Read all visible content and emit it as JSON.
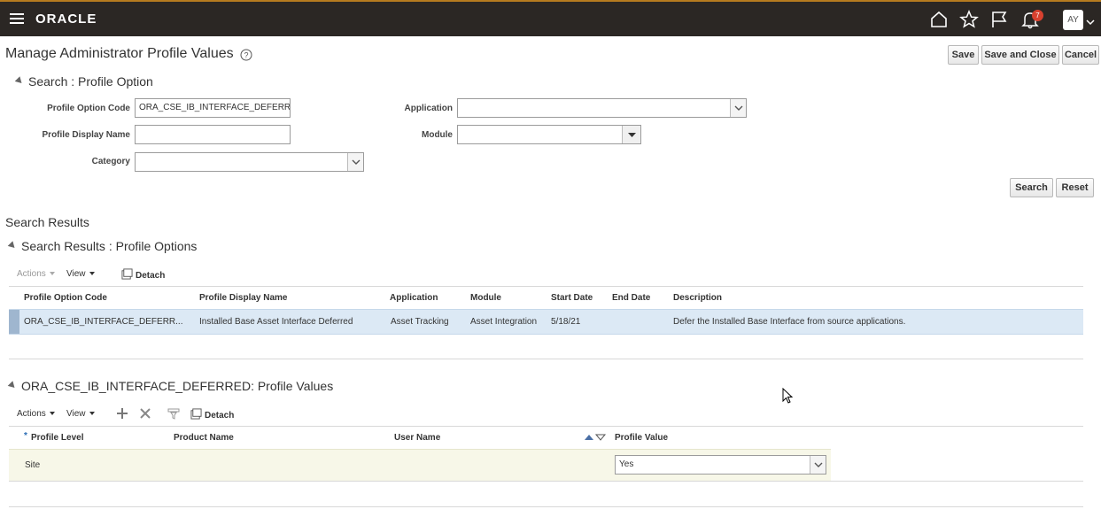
{
  "header": {
    "logo": "ORACLE",
    "notification_count": "7",
    "avatar_initials": "AY"
  },
  "page": {
    "title": "Manage Administrator Profile Values",
    "save_label": "Save",
    "save_close_label": "Save and Close",
    "cancel_label": "Cancel"
  },
  "search": {
    "section_title": "Search : Profile Option",
    "profile_option_code_label": "Profile Option Code",
    "profile_option_code_value": "ORA_CSE_IB_INTERFACE_DEFERRED",
    "profile_display_name_label": "Profile Display Name",
    "profile_display_name_value": "",
    "category_label": "Category",
    "category_value": "",
    "application_label": "Application",
    "application_value": "",
    "module_label": "Module",
    "module_value": "",
    "search_label": "Search",
    "reset_label": "Reset"
  },
  "results": {
    "heading": "Search Results",
    "section_title": "Search Results : Profile Options",
    "actions_label": "Actions",
    "view_label": "View",
    "detach_label": "Detach",
    "columns": [
      "Profile Option Code",
      "Profile Display Name",
      "Application",
      "Module",
      "Start Date",
      "End Date",
      "Description"
    ],
    "rows": [
      {
        "code": "ORA_CSE_IB_INTERFACE_DEFERR...",
        "display_name": "Installed Base Asset Interface Deferred",
        "application": "Asset Tracking",
        "module": "Asset Integration",
        "start_date": "5/18/21",
        "end_date": "",
        "description": "Defer the Installed Base Interface from source applications."
      }
    ]
  },
  "values": {
    "section_title": "ORA_CSE_IB_INTERFACE_DEFERRED: Profile Values",
    "actions_label": "Actions",
    "view_label": "View",
    "detach_label": "Detach",
    "required_mark": "*",
    "columns": [
      "Profile Level",
      "Product Name",
      "User Name",
      "Profile Value"
    ],
    "rows": [
      {
        "level": "Site",
        "product": "",
        "user": "",
        "value": "Yes"
      }
    ]
  }
}
